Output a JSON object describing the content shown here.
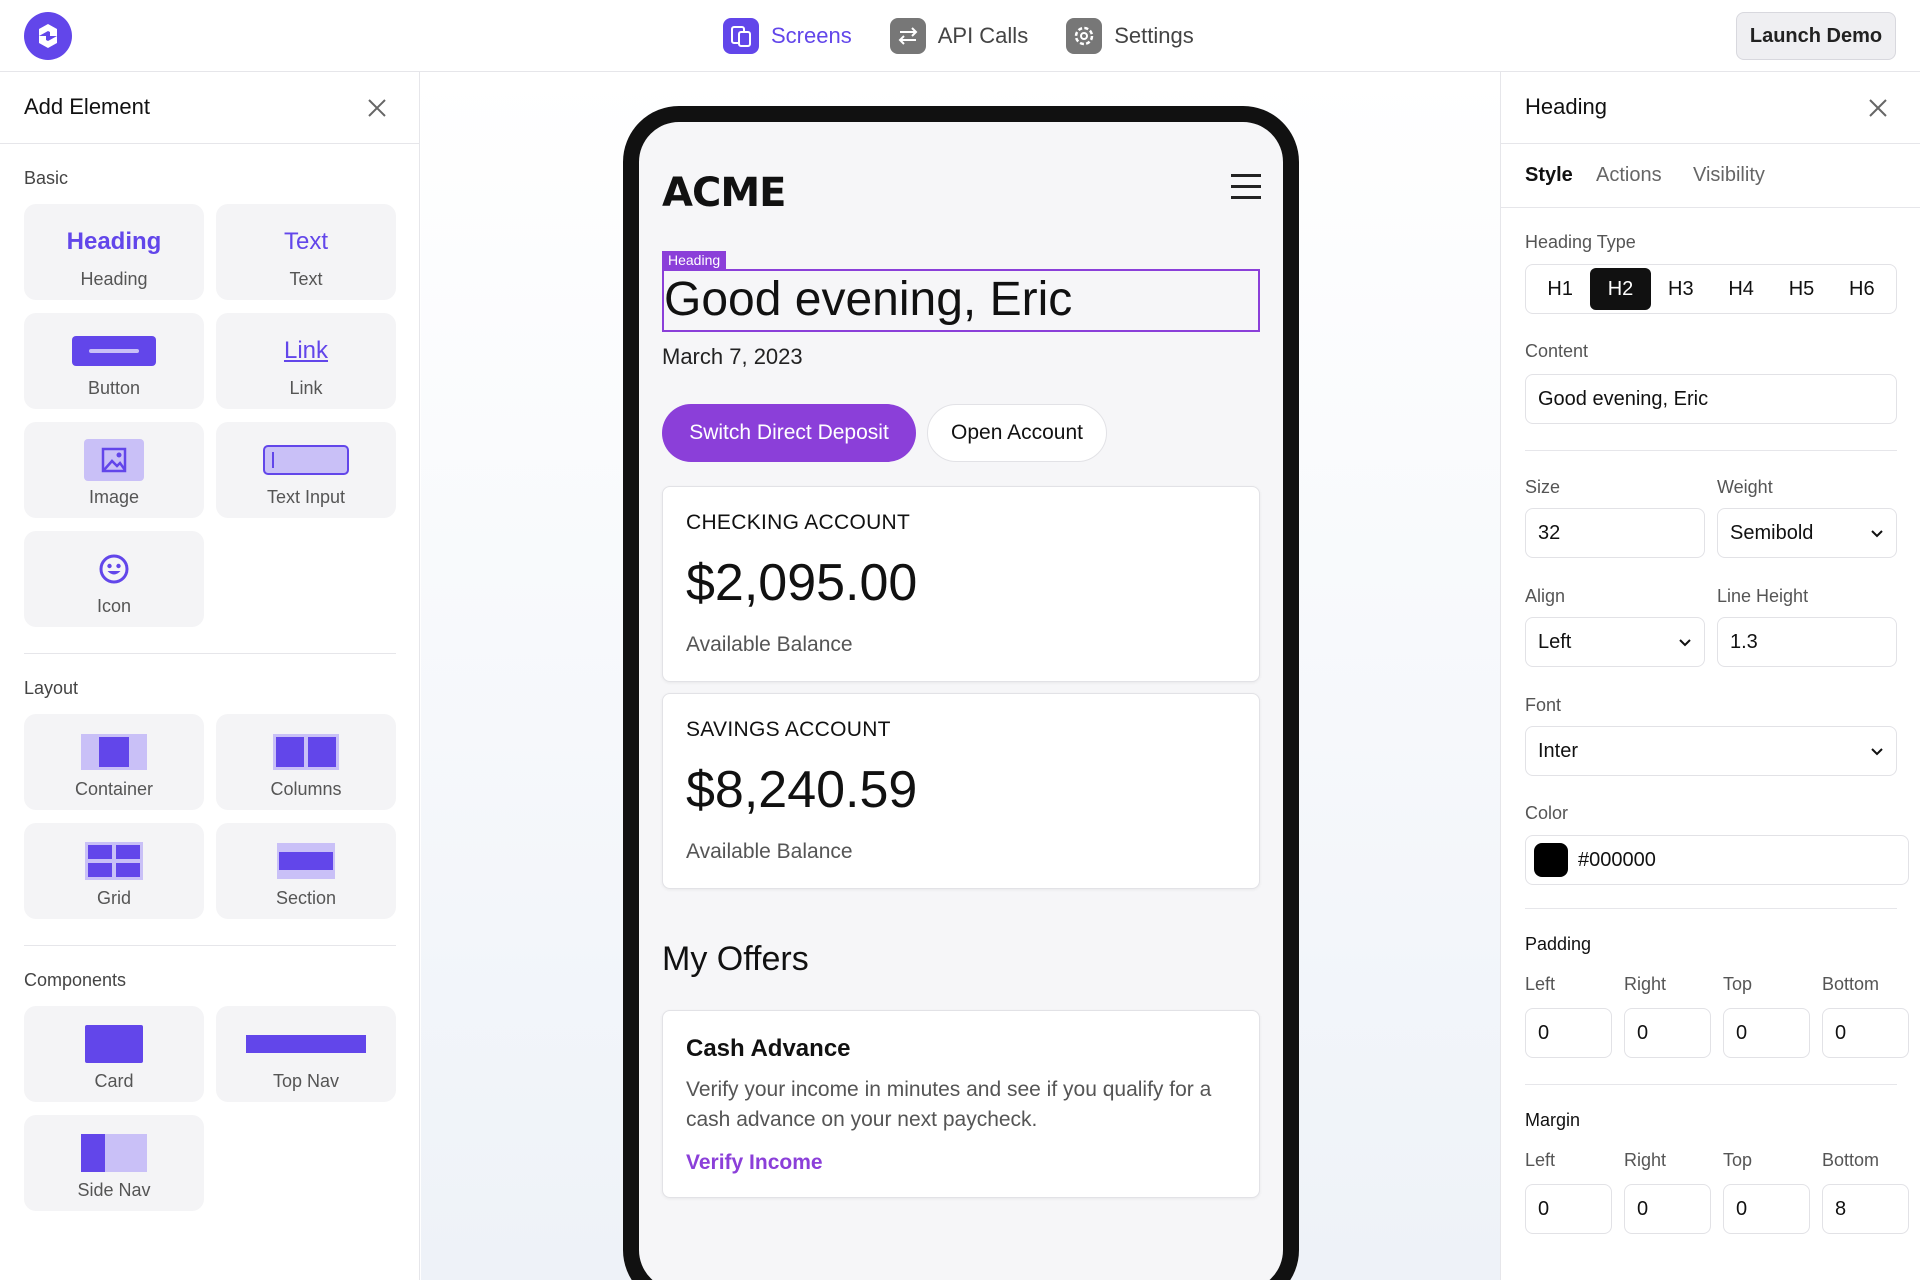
{
  "topbar": {
    "nav": [
      {
        "label": "Screens",
        "icon": "screens-icon",
        "active": true
      },
      {
        "label": "API Calls",
        "icon": "api-calls-icon",
        "active": false
      },
      {
        "label": "Settings",
        "icon": "gear-icon",
        "active": false
      }
    ],
    "launch_label": "Launch Demo"
  },
  "left_panel": {
    "title": "Add Element",
    "sections": {
      "basic": "Basic",
      "layout": "Layout",
      "components": "Components"
    },
    "basic_items": {
      "heading": {
        "preview": "Heading",
        "label": "Heading"
      },
      "text": {
        "preview": "Text",
        "label": "Text"
      },
      "button": {
        "label": "Button"
      },
      "link": {
        "preview": "Link",
        "label": "Link"
      },
      "image": {
        "label": "Image"
      },
      "text_input": {
        "label": "Text Input"
      },
      "icon": {
        "label": "Icon"
      }
    },
    "layout_items": {
      "container": "Container",
      "columns": "Columns",
      "grid": "Grid",
      "section": "Section"
    },
    "component_items": {
      "card": "Card",
      "top_nav": "Top Nav",
      "side_nav": "Side Nav"
    }
  },
  "phone": {
    "brand": "ACME",
    "selection_tag": "Heading",
    "greeting": "Good evening, Eric",
    "date": "March 7, 2023",
    "primary_button": "Switch Direct Deposit",
    "secondary_button": "Open Account",
    "accounts": [
      {
        "name": "CHECKING ACCOUNT",
        "balance": "$2,095.00",
        "sub": "Available Balance"
      },
      {
        "name": "SAVINGS ACCOUNT",
        "balance": "$8,240.59",
        "sub": "Available Balance"
      }
    ],
    "offers_title": "My Offers",
    "offer": {
      "title": "Cash Advance",
      "description": "Verify your income in minutes and see if you qualify for a cash advance on your next paycheck.",
      "link": "Verify Income"
    }
  },
  "right_panel": {
    "title": "Heading",
    "tabs": [
      "Style",
      "Actions",
      "Visibility"
    ],
    "heading_type": {
      "label": "Heading Type",
      "options": [
        "H1",
        "H2",
        "H3",
        "H4",
        "H5",
        "H6"
      ],
      "selected": "H2"
    },
    "content": {
      "label": "Content",
      "value": "Good evening, Eric"
    },
    "size": {
      "label": "Size",
      "value": "32"
    },
    "weight": {
      "label": "Weight",
      "value": "Semibold"
    },
    "align": {
      "label": "Align",
      "value": "Left"
    },
    "line_height": {
      "label": "Line Height",
      "value": "1.3"
    },
    "font": {
      "label": "Font",
      "value": "Inter"
    },
    "color": {
      "label": "Color",
      "value": "#000000"
    },
    "padding": {
      "title": "Padding",
      "labels": [
        "Left",
        "Right",
        "Top",
        "Bottom"
      ],
      "values": [
        "0",
        "0",
        "0",
        "0"
      ]
    },
    "margin": {
      "title": "Margin",
      "labels": [
        "Left",
        "Right",
        "Top",
        "Bottom"
      ],
      "values": [
        "0",
        "0",
        "0",
        "8"
      ]
    }
  },
  "colors": {
    "accent": "#6246ea",
    "brand_purple": "#8b3fd9",
    "selected_segment": "#111111"
  }
}
